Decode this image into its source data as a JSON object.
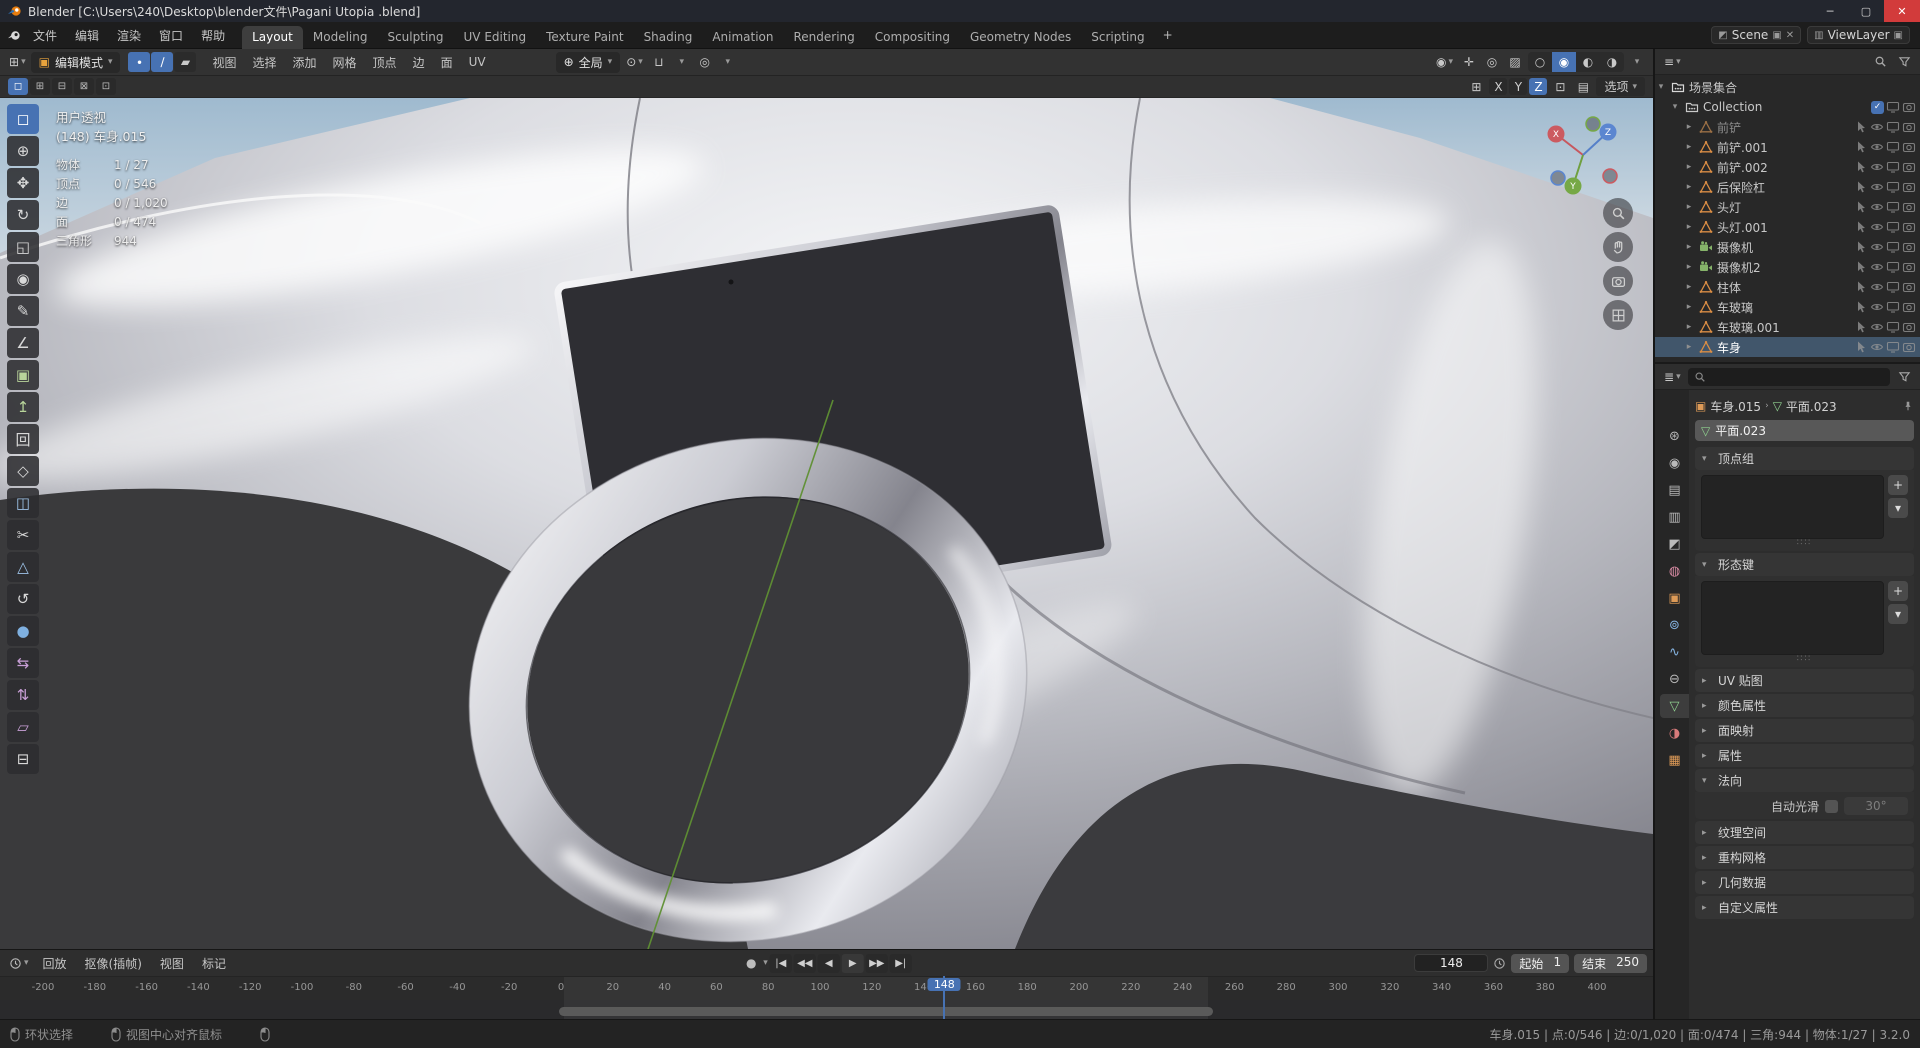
{
  "window": {
    "title": "Blender [C:\\Users\\240\\Desktop\\blender文件\\Pagani Utopia .blend]",
    "controls": {
      "minimize": "─",
      "maximize": "▢",
      "close": "✕"
    }
  },
  "topbar": {
    "menus": [
      "文件",
      "编辑",
      "渲染",
      "窗口",
      "帮助"
    ],
    "workspaces": [
      "Layout",
      "Modeling",
      "Sculpting",
      "UV Editing",
      "Texture Paint",
      "Shading",
      "Animation",
      "Rendering",
      "Compositing",
      "Geometry Nodes",
      "Scripting"
    ],
    "active_workspace": "Layout",
    "add_workspace": "+",
    "scene": {
      "label": "Scene"
    },
    "viewlayer": {
      "label": "ViewLayer"
    }
  },
  "viewport_header": {
    "mode": "编辑模式",
    "select_modes": [
      {
        "name": "vertex",
        "glyph": "∙",
        "active": true
      },
      {
        "name": "edge",
        "glyph": "∕",
        "active": true
      },
      {
        "name": "face",
        "glyph": "▰",
        "active": false
      }
    ],
    "menus": [
      "视图",
      "选择",
      "添加",
      "网格",
      "顶点",
      "边",
      "面",
      "UV"
    ],
    "orientation": "全局",
    "shading_modes": [
      {
        "name": "wireframe",
        "glyph": "○",
        "active": false
      },
      {
        "name": "solid",
        "glyph": "◉",
        "active": true
      },
      {
        "name": "material",
        "glyph": "◐",
        "active": false
      },
      {
        "name": "rendered",
        "glyph": "◑",
        "active": false
      }
    ]
  },
  "tool_settings": {
    "select_ops": [
      "◻",
      "⊞",
      "⊟",
      "⊠",
      "⊡"
    ],
    "axes": [
      "X",
      "Y",
      "Z"
    ],
    "active_axis": "Z",
    "options_label": "选项"
  },
  "viewport": {
    "overlay": {
      "view": "用户透视",
      "object": "(148) 车身.015",
      "stats": [
        {
          "label": "物体",
          "value": "1 / 27"
        },
        {
          "label": "顶点",
          "value": "0 / 546"
        },
        {
          "label": "边",
          "value": "0 / 1,020"
        },
        {
          "label": "面",
          "value": "0 / 474"
        },
        {
          "label": "三角形",
          "value": "944"
        }
      ]
    },
    "gizmo_axes": [
      "X",
      "Y",
      "Z"
    ]
  },
  "tools": [
    {
      "name": "tweak-select",
      "glyph": "◻",
      "active": true
    },
    {
      "name": "cursor",
      "glyph": "⊕"
    },
    {
      "name": "move",
      "glyph": "✥"
    },
    {
      "name": "rotate",
      "glyph": "↻"
    },
    {
      "name": "scale",
      "glyph": "◱"
    },
    {
      "name": "transform",
      "glyph": "◉"
    },
    {
      "name": "annotate",
      "glyph": "✎"
    },
    {
      "name": "measure",
      "glyph": "∠"
    },
    {
      "name": "add-cube",
      "glyph": "▣",
      "color": "#b8d49a"
    },
    {
      "name": "extrude-region",
      "glyph": "↥",
      "color": "#b8d49a"
    },
    {
      "name": "inset-faces",
      "glyph": "回"
    },
    {
      "name": "bevel",
      "glyph": "◇"
    },
    {
      "name": "loop-cut",
      "glyph": "◫",
      "color": "#9ec3e8"
    },
    {
      "name": "knife",
      "glyph": "✂"
    },
    {
      "name": "poly-build",
      "glyph": "△",
      "color": "#9ec3e8"
    },
    {
      "name": "spin",
      "glyph": "↺"
    },
    {
      "name": "smooth",
      "glyph": "●",
      "color": "#7fb0e0"
    },
    {
      "name": "edge-slide",
      "glyph": "⇆",
      "color": "#caa0d8"
    },
    {
      "name": "shrink-fatten",
      "glyph": "⇅",
      "color": "#caa0d8"
    },
    {
      "name": "shear",
      "glyph": "▱",
      "color": "#caa0d8"
    },
    {
      "name": "rip-region",
      "glyph": "⊟"
    }
  ],
  "outliner": {
    "scene_collection": "场景集合",
    "collection": {
      "name": "Collection",
      "checked": true
    },
    "items": [
      {
        "name": "前铲",
        "type": "mesh",
        "dim": true
      },
      {
        "name": "前铲.001",
        "type": "mesh"
      },
      {
        "name": "前铲.002",
        "type": "mesh"
      },
      {
        "name": "后保险杠",
        "type": "mesh"
      },
      {
        "name": "头灯",
        "type": "mesh"
      },
      {
        "name": "头灯.001",
        "type": "mesh"
      },
      {
        "name": "摄像机",
        "type": "camera"
      },
      {
        "name": "摄像机2",
        "type": "camera"
      },
      {
        "name": "柱体",
        "type": "mesh"
      },
      {
        "name": "车玻璃",
        "type": "mesh"
      },
      {
        "name": "车玻璃.001",
        "type": "mesh"
      },
      {
        "name": "车身",
        "type": "mesh",
        "active": true
      }
    ]
  },
  "properties": {
    "breadcrumb": {
      "object": "车身.015",
      "separator": "›",
      "data": "平面.023"
    },
    "datablock": "平面.023",
    "tabs": [
      {
        "name": "tool",
        "glyph": "⊛",
        "color": "#b9b9b9"
      },
      {
        "name": "render",
        "glyph": "◉",
        "color": "#b9b9b9"
      },
      {
        "name": "output",
        "glyph": "▤",
        "color": "#b9b9b9"
      },
      {
        "name": "view-layer",
        "glyph": "▥",
        "color": "#b9b9b9"
      },
      {
        "name": "scene",
        "glyph": "◩",
        "color": "#b9b9b9"
      },
      {
        "name": "world",
        "glyph": "◍",
        "color": "#d98ba4"
      },
      {
        "name": "object",
        "glyph": "▣",
        "color": "#dd9a57"
      },
      {
        "name": "modifiers",
        "glyph": "⊚",
        "color": "#85b3e0"
      },
      {
        "name": "physics",
        "glyph": "∿",
        "color": "#85b3e0"
      },
      {
        "name": "constraints",
        "glyph": "⊖",
        "color": "#b9b9b9"
      },
      {
        "name": "object-data",
        "glyph": "▽",
        "color": "#8fd08f",
        "active": true
      },
      {
        "name": "material",
        "glyph": "◑",
        "color": "#d97b7b"
      },
      {
        "name": "texture",
        "glyph": "▦",
        "color": "#dd9a57"
      }
    ],
    "panels": [
      {
        "label": "顶点组",
        "state": "open",
        "kind": "list",
        "body_h": 64
      },
      {
        "label": "形态键",
        "state": "open",
        "kind": "list",
        "body_h": 74
      },
      {
        "label": "UV 贴图",
        "state": "closed"
      },
      {
        "label": "颜色属性",
        "state": "closed"
      },
      {
        "label": "面映射",
        "state": "closed"
      },
      {
        "label": "属性",
        "state": "closed"
      },
      {
        "label": "法向",
        "state": "open",
        "kind": "normals"
      },
      {
        "label": "纹理空间",
        "state": "closed"
      },
      {
        "label": "重构网格",
        "state": "closed"
      },
      {
        "label": "几何数据",
        "state": "closed"
      },
      {
        "label": "自定义属性",
        "state": "closed"
      }
    ],
    "normals": {
      "label": "自动光滑",
      "value": "30°",
      "checked": false
    }
  },
  "timeline": {
    "menus": [
      "回放",
      "抠像(插帧)",
      "视图",
      "标记"
    ],
    "transport": [
      "|◀",
      "◀◀",
      "◀",
      "▶",
      "▶▶",
      "▶|"
    ],
    "ticks": [
      -200,
      -180,
      -160,
      -140,
      -120,
      -100,
      -80,
      -60,
      -40,
      -20,
      0,
      20,
      40,
      60,
      80,
      100,
      120,
      140,
      160,
      180,
      200,
      220,
      240,
      260,
      280,
      300,
      320,
      340,
      360,
      380,
      400
    ],
    "current_frame": "148",
    "frame_start": 1,
    "frame_end": 250,
    "start_label": "起始",
    "start_value": "1",
    "end_label": "结束",
    "end_value": "250"
  },
  "statusbar": {
    "hints": [
      "环状选择",
      "视图中心对齐鼠标",
      ""
    ],
    "info": "车身.015 | 点:0/546 | 边:0/1,020 | 面:0/474 | 三角:944 | 物体:1/27 | 3.2.0"
  }
}
